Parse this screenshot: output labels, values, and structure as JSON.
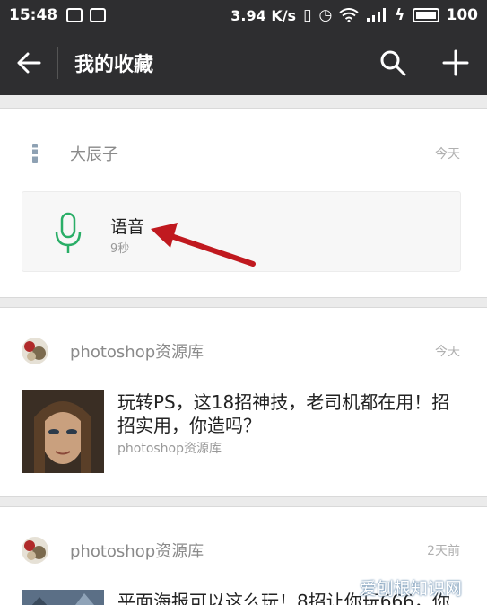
{
  "status_bar": {
    "time": "15:48",
    "network_speed": "3.94 K/s",
    "battery": "100"
  },
  "nav": {
    "title": "我的收藏"
  },
  "items": [
    {
      "source": "大辰子",
      "date": "今天",
      "type": "voice",
      "title": "语音",
      "duration": "9秒",
      "icon": "microphone-icon"
    },
    {
      "source": "photoshop资源库",
      "date": "今天",
      "type": "article",
      "title": "玩转PS，这18招神技，老司机都在用！招招实用，你造吗？",
      "article_source": "photoshop资源库"
    },
    {
      "source": "photoshop资源库",
      "date": "2天前",
      "type": "article",
      "title": "平面海报可以这么玩！8招让你玩666，你"
    }
  ],
  "watermark": "爱刨根知识网",
  "colors": {
    "bar_bg": "#2e2e30",
    "mic_green": "#2aae67",
    "arrow_red": "#c0191f"
  }
}
